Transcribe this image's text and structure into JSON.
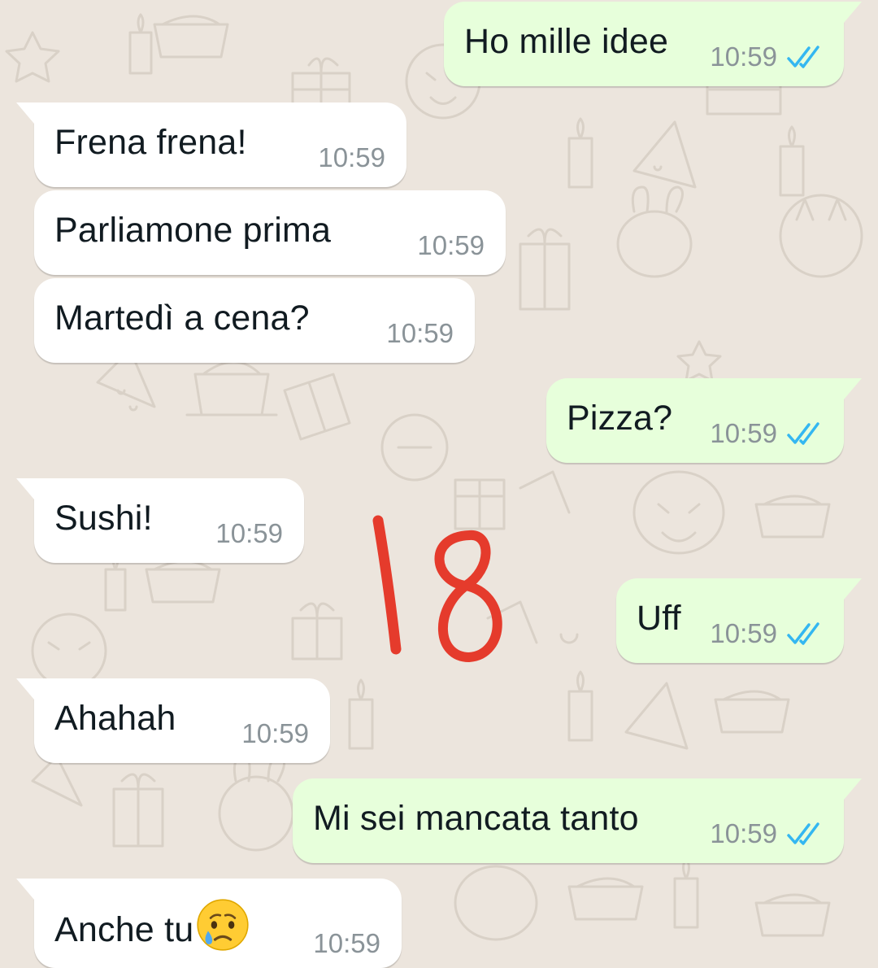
{
  "chat": {
    "messages": [
      {
        "direction": "out",
        "text": "Ho mille idee",
        "time": "10:59",
        "status": "read"
      },
      {
        "direction": "in",
        "text": "Frena frena!",
        "time": "10:59"
      },
      {
        "direction": "in",
        "text": "Parliamone prima",
        "time": "10:59"
      },
      {
        "direction": "in",
        "text": "Martedì a cena?",
        "time": "10:59"
      },
      {
        "direction": "out",
        "text": "Pizza?",
        "time": "10:59",
        "status": "read"
      },
      {
        "direction": "in",
        "text": "Sushi!",
        "time": "10:59"
      },
      {
        "direction": "out",
        "text": "Uff",
        "time": "10:59",
        "status": "read"
      },
      {
        "direction": "in",
        "text": "Ahahah",
        "time": "10:59"
      },
      {
        "direction": "out",
        "text": "Mi sei mancata tanto",
        "time": "10:59",
        "status": "read"
      },
      {
        "direction": "in",
        "text": "Anche tu",
        "emoji": "crying-face-emoji",
        "time": "10:59"
      }
    ]
  },
  "annotation": {
    "text": "18",
    "color": "#e53b2c"
  },
  "colors": {
    "background": "#ece5dd",
    "incoming_bubble": "#ffffff",
    "outgoing_bubble": "#e7ffdb",
    "read_ticks": "#34b7f1",
    "time_text": "#8a9398"
  },
  "icons": {
    "read_receipt": "double-check-icon",
    "wallpaper": "doodle-pattern"
  }
}
